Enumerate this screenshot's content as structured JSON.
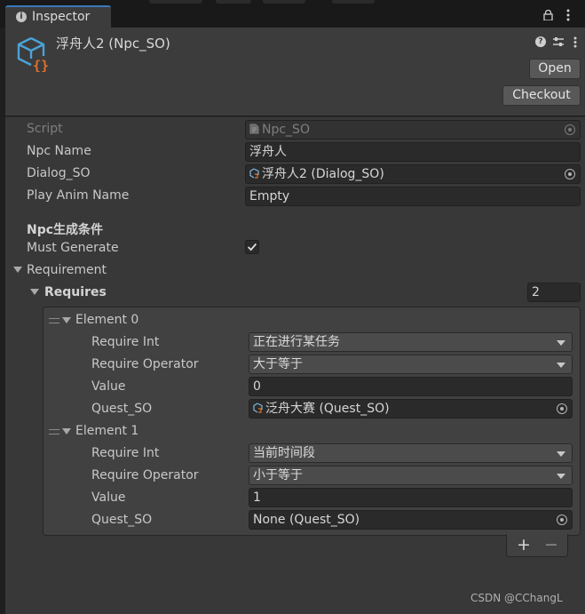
{
  "tab": {
    "label": "Inspector"
  },
  "header": {
    "title": "浮舟人2 (Npc_SO)",
    "open_label": "Open",
    "checkout_label": "Checkout"
  },
  "fields": {
    "script": {
      "label": "Script",
      "value": "Npc_SO"
    },
    "npc_name": {
      "label": "Npc Name",
      "value": "浮舟人"
    },
    "dialog_so": {
      "label": "Dialog_SO",
      "value": "浮舟人2 (Dialog_SO)"
    },
    "play_anim": {
      "label": "Play Anim Name",
      "value": "Empty"
    }
  },
  "section": {
    "title": "Npc生成条件"
  },
  "must_generate": {
    "label": "Must Generate",
    "checked": true
  },
  "requirement": {
    "label": "Requirement"
  },
  "requires": {
    "label": "Requires",
    "count": "2"
  },
  "elements": [
    {
      "title": "Element 0",
      "require_int": {
        "label": "Require Int",
        "value": "正在进行某任务"
      },
      "require_operator": {
        "label": "Require Operator",
        "value": "大于等于"
      },
      "value": {
        "label": "Value",
        "value": "0"
      },
      "quest_so": {
        "label": "Quest_SO",
        "value": "泛舟大赛 (Quest_SO)"
      }
    },
    {
      "title": "Element 1",
      "require_int": {
        "label": "Require Int",
        "value": "当前时间段"
      },
      "require_operator": {
        "label": "Require Operator",
        "value": "小于等于"
      },
      "value": {
        "label": "Value",
        "value": "1"
      },
      "quest_so": {
        "label": "Quest_SO",
        "value": "None (Quest_SO)"
      }
    }
  ],
  "list_controls": {
    "add": "+",
    "remove": "−"
  },
  "watermark": "CSDN @CChangL",
  "icons": {
    "tab": "info-icon",
    "lock": "lock-icon",
    "header": "scriptable-object-icon",
    "help": "help-icon",
    "preset": "preset-icon",
    "menu": "more-vertical-icon",
    "target": "object-picker-icon"
  },
  "colors": {
    "tab_accent": "#3a79bb",
    "so_icon": "#4aa3d8",
    "so_braces": "#e0702a"
  }
}
